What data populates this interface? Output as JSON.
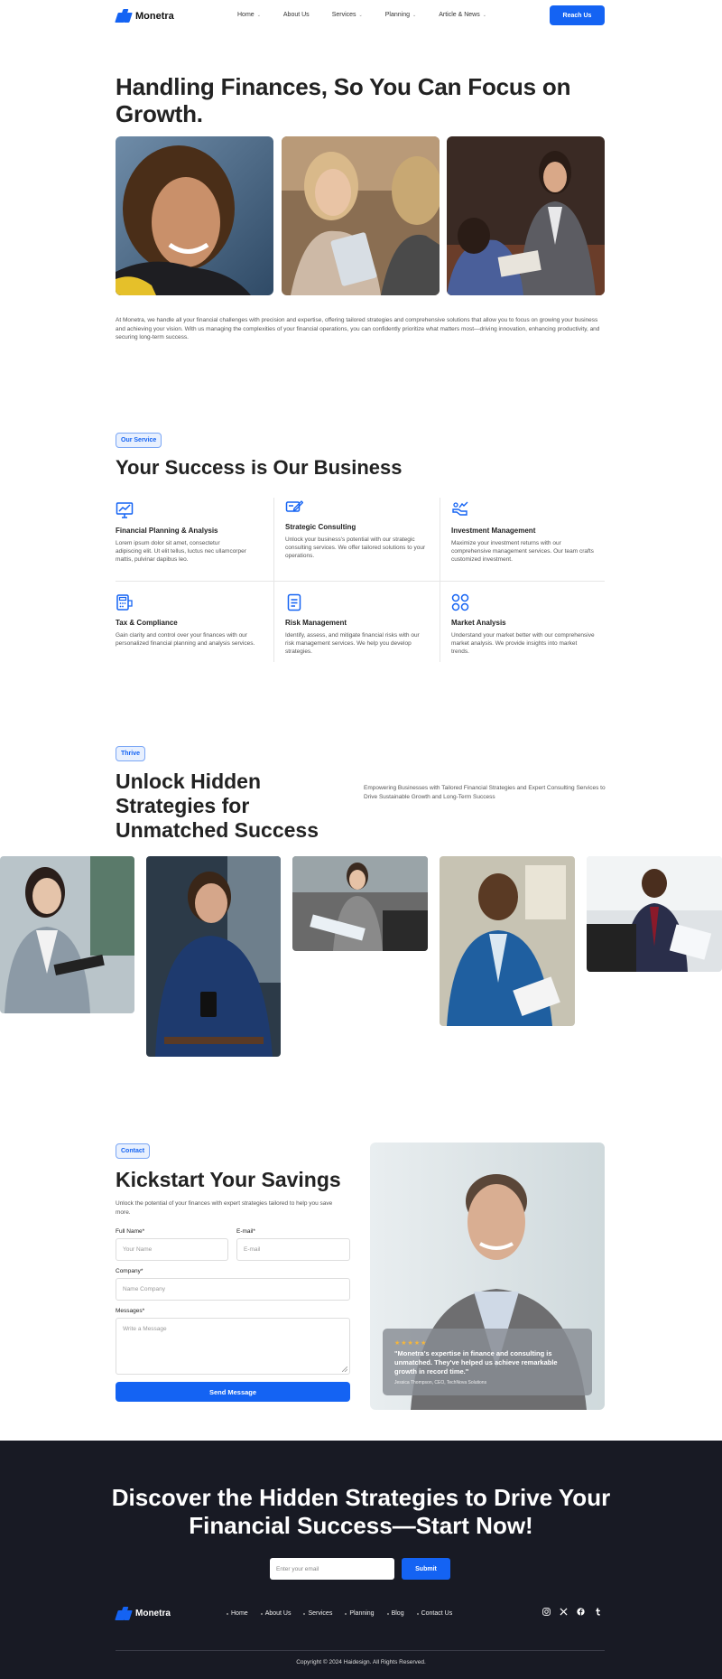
{
  "brand": {
    "name": "Monetra",
    "accent": "#1463f3",
    "dark": "#181a24"
  },
  "nav": {
    "links": [
      {
        "label": "Home",
        "has_dropdown": true
      },
      {
        "label": "About Us",
        "has_dropdown": false
      },
      {
        "label": "Services",
        "has_dropdown": true
      },
      {
        "label": "Planning",
        "has_dropdown": true
      },
      {
        "label": "Article & News",
        "has_dropdown": true
      }
    ],
    "cta": "Reach Us"
  },
  "hero": {
    "title": "Handling Finances, So You Can Focus on Growth.",
    "description": "At Monetra, we handle all your financial challenges with precision and expertise, offering tailored strategies and comprehensive solutions that allow you to focus on growing your business and achieving your vision. With us managing the complexities of your financial operations, you can confidently prioritize what matters most—driving innovation, enhancing productivity, and securing long-term success."
  },
  "services": {
    "badge": "Our Service",
    "title": "Your Success is Our Business",
    "items": [
      {
        "icon": "chart-presentation-icon",
        "title": "Financial Planning & Analysis",
        "desc": "Lorem ipsum dolor sit amet, consectetur adipiscing elit. Ut elit tellus, luctus nec ullamcorper mattis, pulvinar dapibus leo."
      },
      {
        "icon": "pen-card-icon",
        "title": "Strategic Consulting",
        "desc": "Unlock your business's potential with our strategic consulting services. We offer tailored solutions to your operations."
      },
      {
        "icon": "hand-growth-icon",
        "title": "Investment Management",
        "desc": "Maximize your investment returns with our comprehensive management services. Our team crafts customized investment."
      },
      {
        "icon": "calculator-icon",
        "title": "Tax & Compliance",
        "desc": "Gain clarity and control over your finances with our personalized financial planning and analysis services."
      },
      {
        "icon": "document-icon",
        "title": "Risk Management",
        "desc": "Identify, assess, and mitigate financial risks with our risk management services. We help you develop strategies."
      },
      {
        "icon": "grid-circles-icon",
        "title": "Market Analysis",
        "desc": "Understand your market better with our comprehensive market analysis. We provide insights into market trends."
      }
    ]
  },
  "thrive": {
    "badge": "Thrive",
    "title": "Unlock Hidden Strategies for Unmatched Success",
    "description": "Empowering Businesses with Tailored Financial Strategies and Expert Consulting Services to Drive Sustainable Growth and Long-Term Success"
  },
  "contact": {
    "badge": "Contact",
    "title": "Kickstart Your Savings",
    "subtitle": "Unlock the potential of your finances with expert strategies tailored to help you save more.",
    "fields": {
      "full_name_label": "Full Name*",
      "full_name_placeholder": "Your Name",
      "email_label": "E-mail*",
      "email_placeholder": "E-mail",
      "company_label": "Company*",
      "company_placeholder": "Name Company",
      "messages_label": "Messages*",
      "messages_placeholder": "Write a Message"
    },
    "submit": "Send Message",
    "testimonial": {
      "stars": "★★★★★",
      "rating": 5,
      "quote": "\"Monetra's expertise in finance and consulting is unmatched. They've helped us achieve remarkable growth in record time.\"",
      "author": "Jessica Thompson, CEO, TechNova Solutions"
    }
  },
  "footer": {
    "cta_title": "Discover the Hidden Strategies to Drive Your Financial Success—Start Now!",
    "email_placeholder": "Enter your email",
    "submit": "Submit",
    "links": [
      "Home",
      "About Us",
      "Services",
      "Planning",
      "Blog",
      "Contact Us"
    ],
    "socials": [
      "instagram-icon",
      "x-icon",
      "facebook-icon",
      "tumblr-icon"
    ],
    "copyright": "Copyright © 2024 Haidesign. All Rights Reserved."
  }
}
